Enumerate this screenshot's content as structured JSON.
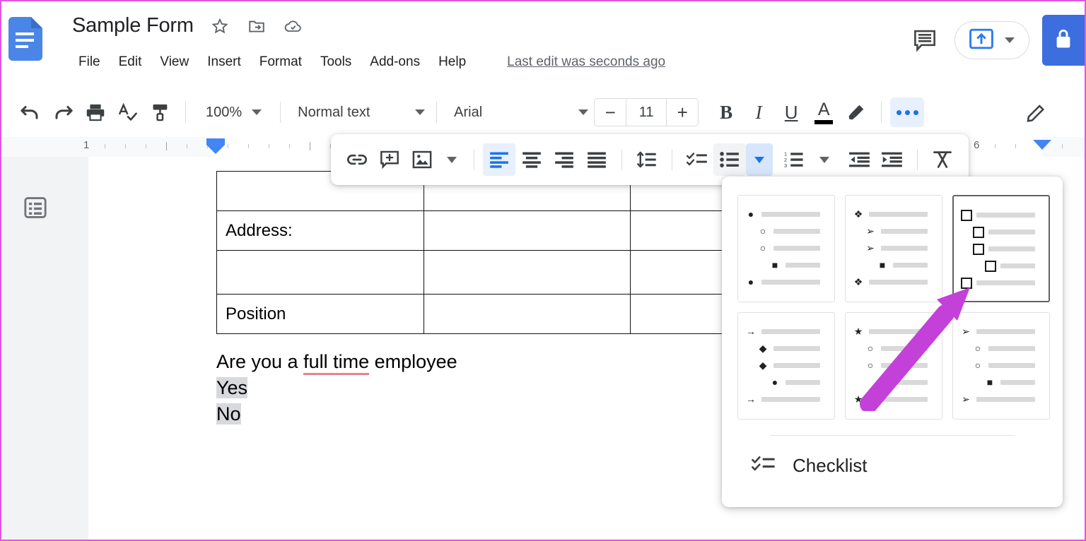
{
  "app": {
    "name": "Google Docs",
    "logo_icon": "docs-file-icon"
  },
  "header": {
    "title": "Sample Form",
    "star_icon": "star-icon",
    "move_icon": "move-to-folder-icon",
    "cloud_icon": "cloud-saved-icon",
    "menus": [
      "File",
      "Edit",
      "View",
      "Insert",
      "Format",
      "Tools",
      "Add-ons",
      "Help"
    ],
    "last_edit": "Last edit was seconds ago",
    "comment_icon": "comment-history-icon",
    "present_icon": "present-upload-icon",
    "present_caret_icon": "chevron-down-icon",
    "lock_icon": "lock-icon",
    "lock_button_color": "#3c6ee0"
  },
  "toolbar": {
    "undo_icon": "undo-icon",
    "redo_icon": "redo-icon",
    "print_icon": "print-icon",
    "spellcheck_icon": "spellcheck-icon",
    "paint_format_icon": "paint-format-icon",
    "zoom_value": "100%",
    "style_value": "Normal text",
    "font_value": "Arial",
    "font_size_value": "11",
    "font_size_decrease": "−",
    "font_size_increase": "+",
    "bold_label": "B",
    "italic_label": "I",
    "underline_label": "U",
    "text_color_label": "A",
    "highlight_icon": "highlight-pen-icon",
    "more_icon": "more-options-icon"
  },
  "ruler": {
    "left_number": "1",
    "right_number": "6",
    "left_indent_icon": "left-indent-marker",
    "right_indent_icon": "right-indent-marker"
  },
  "floating_toolbar": {
    "link_icon": "insert-link-icon",
    "comment_icon": "add-comment-icon",
    "image_icon": "insert-image-icon",
    "image_caret_icon": "chevron-down-icon",
    "align_left_icon": "align-left-icon",
    "align_center_icon": "align-center-icon",
    "align_right_icon": "align-right-icon",
    "align_justify_icon": "align-justify-icon",
    "line_spacing_icon": "line-spacing-icon",
    "checklist_icon": "checklist-icon",
    "bulleted_list_icon": "bulleted-list-icon",
    "bulleted_list_caret_icon": "chevron-down-icon",
    "numbered_list_icon": "numbered-list-icon",
    "numbered_list_caret_icon": "chevron-down-icon",
    "decrease_indent_icon": "decrease-indent-icon",
    "increase_indent_icon": "increase-indent-icon",
    "clear_formatting_icon": "clear-formatting-icon",
    "active_alignment": "align-left"
  },
  "bullet_panel": {
    "selected_index": 2,
    "presets": [
      {
        "name": "disc-circle-square",
        "bullets": [
          "●",
          "○",
          "○",
          "■",
          "●"
        ]
      },
      {
        "name": "diamond-arrowhead-square",
        "bullets": [
          "❖",
          "➢",
          "➢",
          "■",
          "❖"
        ]
      },
      {
        "name": "shadowed-square",
        "bullets": [
          "sq3d",
          "sq3d",
          "sq3d",
          "sq3d",
          "sq3d"
        ]
      },
      {
        "name": "arrow-diamond-disc",
        "bullets": [
          "→",
          "◆",
          "◆",
          "●",
          "→"
        ]
      },
      {
        "name": "star-circle-square",
        "bullets": [
          "★",
          "○",
          "○",
          "■",
          "★"
        ]
      },
      {
        "name": "arrowhead-circle-square",
        "bullets": [
          "➢",
          "○",
          "○",
          "■",
          "➢"
        ]
      }
    ],
    "checklist_label": "Checklist",
    "checklist_icon": "checklist-icon"
  },
  "document": {
    "outline_icon": "document-outline-icon",
    "table": {
      "rows": [
        {
          "cells": [
            "",
            "",
            ""
          ]
        },
        {
          "cells": [
            "Address:",
            "",
            ""
          ]
        },
        {
          "cells": [
            "",
            "",
            ""
          ]
        },
        {
          "cells": [
            "Position",
            "",
            ""
          ]
        }
      ]
    },
    "paragraph": {
      "prefix": "Are you a ",
      "misspelled": "full time",
      "suffix": " employee"
    },
    "options": [
      {
        "text": "Yes",
        "selected": true
      },
      {
        "text": "No",
        "selected": true
      }
    ]
  },
  "annotation": {
    "arrow_color": "#c341d9",
    "arrow_name": "purple-pointer-arrow"
  }
}
